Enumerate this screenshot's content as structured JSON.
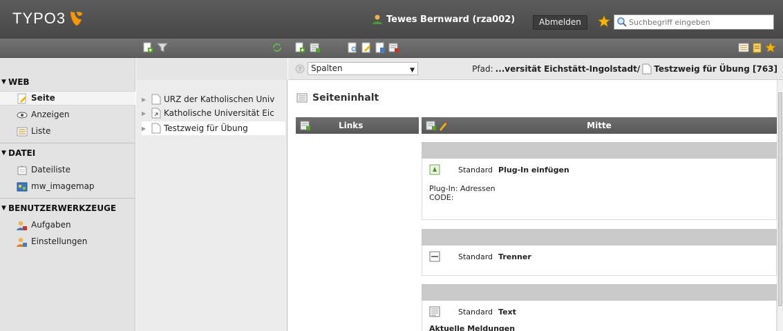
{
  "topbar": {
    "logo_text": "TYPO3",
    "user_name": "Tewes Bernward (rza002)",
    "logout_label": "Abmelden",
    "search_placeholder": "Suchbegriff eingeben"
  },
  "modules": {
    "groups": [
      {
        "label": "WEB",
        "items": [
          "Seite",
          "Anzeigen",
          "Liste"
        ]
      },
      {
        "label": "DATEI",
        "items": [
          "Dateiliste",
          "mw_imagemap"
        ]
      },
      {
        "label": "BENUTZERWERKZEUGE",
        "items": [
          "Aufgaben",
          "Einstellungen"
        ]
      }
    ],
    "active": "Seite"
  },
  "tree": {
    "items": [
      "URZ der Katholischen Univ",
      "Katholische Universität Eic",
      "Testzweig für Übung"
    ],
    "selected": "Testzweig für Übung"
  },
  "docheader": {
    "function_value": "Spalten",
    "path_label": "Pfad:",
    "path_value": "...versität Eichstätt-Ingolstadt/",
    "page_title": "Testzweig für Übung [763]"
  },
  "content": {
    "section_title": "Seiteninhalt",
    "columns": [
      "Links",
      "Mitte"
    ],
    "elements": [
      {
        "type": "Standard",
        "title": "Plug-In einfügen",
        "text": "Plug-In: Adressen\nCODE:"
      },
      {
        "type": "Standard",
        "title": "Trenner",
        "text": ""
      },
      {
        "type": "Standard",
        "title": "Text",
        "text": "Aktuelle Meldungen"
      }
    ]
  },
  "colors": {
    "topbar": "#4f4f4f",
    "toolbar": "#666666",
    "accent_orange": "#f49700",
    "column_header": "#636363",
    "element_bar": "#c9c9c9"
  }
}
